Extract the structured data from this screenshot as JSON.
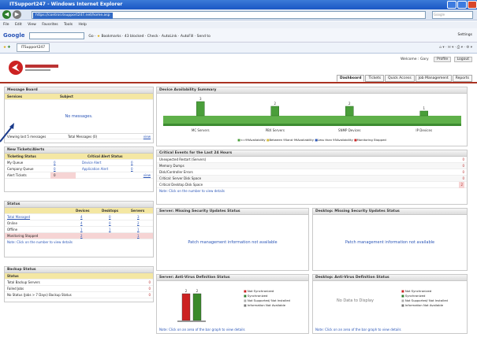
{
  "window": {
    "title": "ITSupport247 - Windows Internet Explorer"
  },
  "address": {
    "url": "https://control.itsupport247.net/home.asp",
    "search_placeholder": "Google"
  },
  "menu": [
    "File",
    "Edit",
    "View",
    "Favorites",
    "Tools",
    "Help"
  ],
  "google_bar": {
    "brand": "Google",
    "items": [
      "Go",
      "Bookmarks",
      "43 blocked",
      "Check",
      "AutoLink",
      "AutoFill",
      "Send to"
    ],
    "settings": "Settings"
  },
  "favorites": {
    "tab": "ITSupport247"
  },
  "header": {
    "welcome": "Welcome : Gary",
    "profile": "Profile",
    "logout": "Logout",
    "tabs": [
      "Dashboard",
      "Tickets",
      "Quick Access",
      "Job Management",
      "Reports"
    ]
  },
  "message_board": {
    "title": "Message Board",
    "cols": [
      "Services",
      "Subject"
    ],
    "empty": "No messages.",
    "footer_left": "Viewing last 5 messages",
    "footer_mid": "Total Messages (0)",
    "footer_link": "view"
  },
  "tickets": {
    "title": "New Tickets/Alerts",
    "cols": [
      "Ticketing Status",
      "",
      "Critical Alert Status"
    ],
    "rows": [
      [
        "My Queue",
        "0",
        "Device Alert",
        "0"
      ],
      [
        "Company Queue",
        "0",
        "Application Alert",
        "0"
      ],
      [
        "Alert Tickets",
        "0",
        "",
        ""
      ]
    ],
    "link": "view"
  },
  "status": {
    "title": "Status",
    "cols": [
      "",
      "Devices",
      "Desktops",
      "Servers"
    ],
    "rows": [
      [
        "Total Managed",
        "4",
        "0",
        "3"
      ],
      [
        "Online",
        "4",
        "0",
        "2"
      ],
      [
        "Offline",
        "1",
        "1",
        "1"
      ],
      [
        "Monitoring Stopped",
        "2",
        "",
        "1"
      ]
    ],
    "note": "Note: Click on the number to view details"
  },
  "backup": {
    "title": "Backup Status",
    "col": "Status",
    "rows": [
      [
        "Total Backup Servers",
        "0"
      ],
      [
        "Failed Jobs",
        "0"
      ],
      [
        "No Status (Jobs > 7 Days) Backup Status",
        "0"
      ]
    ]
  },
  "availability": {
    "title": "Device Availability Summary",
    "legend": [
      "<=99Availability",
      "Between 95and 99Availability",
      "Less than 95Availability",
      "Monitoring Stopped"
    ]
  },
  "chart_data": [
    {
      "type": "bar",
      "title": "Device Availability Summary",
      "categories": [
        "MC Servers",
        "PBX Servers",
        "SNMP Devices",
        "IP Devices"
      ],
      "values": [
        3,
        2,
        2,
        1
      ]
    },
    {
      "type": "bar",
      "title": "Server: Anti-Virus Definition Status",
      "categories": [
        "Not Synchronized",
        "Synchronized"
      ],
      "values": [
        2,
        2
      ],
      "legend": [
        "Not Synchronized",
        "Synchronized",
        "Not Supported/ Not Installed",
        "Information Not Available"
      ]
    }
  ],
  "critical": {
    "title": "Critical Events for the Last 24 Hours",
    "rows": [
      [
        "Unexpected Restart (Servers)",
        "0"
      ],
      [
        "Memory Dumps",
        "0"
      ],
      [
        "Disk/Controller Errors",
        "0"
      ],
      [
        "Critical: Server Disk Space",
        "0"
      ],
      [
        "Critical Desktop Disk Space",
        "2"
      ]
    ],
    "note": "Note: Click on the number to view details"
  },
  "srv_patch": {
    "title": "Server: Missing Security Updates Status",
    "msg": "Patch management information not available"
  },
  "dsk_patch": {
    "title": "Desktop: Missing Security Updates Status",
    "msg": "Patch management information not available"
  },
  "srv_av": {
    "title": "Server: Anti-Virus Definition Status",
    "note": "Note: Click on an area of the bar graph to view details"
  },
  "dsk_av": {
    "title": "Desktop: Anti-Virus Definition Status",
    "msg": "No Data to Display",
    "note": "Note: Click on an area of the bar graph to view details",
    "legend": [
      "Not Synchronized",
      "Synchronized",
      "Not Supported/ Not Installed",
      "Information Not Available"
    ]
  },
  "colors": {
    "accent": "#316ac5",
    "green": "#4a9e3a",
    "red": "#cc2222",
    "yellow": "#f4e7a3"
  }
}
